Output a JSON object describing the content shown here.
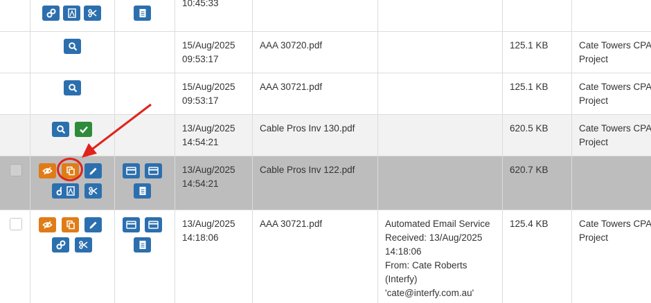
{
  "rows": [
    {
      "datetime": [
        "",
        "10:45:33"
      ],
      "filename": "",
      "source": [],
      "size": "",
      "project": []
    },
    {
      "datetime": [
        "15/Aug/2025",
        "09:53:17"
      ],
      "filename": "AAA 30720.pdf",
      "source": [],
      "size": "125.1 KB",
      "project": [
        "Cate Towers CPAP",
        "Project"
      ]
    },
    {
      "datetime": [
        "15/Aug/2025",
        "09:53:17"
      ],
      "filename": "AAA 30721.pdf",
      "source": [],
      "size": "125.1 KB",
      "project": [
        "Cate Towers CPAP",
        "Project"
      ]
    },
    {
      "datetime": [
        "13/Aug/2025",
        "14:54:21"
      ],
      "filename": "Cable Pros Inv 130.pdf",
      "source": [],
      "size": "620.5 KB",
      "project": [
        "Cate Towers CPAP",
        "Project"
      ]
    },
    {
      "datetime": [
        "13/Aug/2025",
        "14:54:21"
      ],
      "filename": "Cable Pros Inv 122.pdf",
      "source": [],
      "size": "620.7 KB",
      "project": []
    },
    {
      "datetime": [
        "13/Aug/2025",
        "14:18:06"
      ],
      "filename": "AAA 30721.pdf",
      "source": [
        "Automated Email Service",
        "Received: 13/Aug/2025",
        "14:18:06",
        "From: Cate Roberts",
        "(Interfy)",
        "'cate@interfy.com.au'"
      ],
      "size": "125.4 KB",
      "project": [
        "Cate Towers CPAP",
        "Project"
      ]
    }
  ],
  "colors": {
    "blue_button": "#2c6fae",
    "green_button": "#2e8b3a",
    "orange_button": "#e07c17",
    "selected_row": "#bdbdbd",
    "annotation_red": "#e0231a"
  },
  "icons": [
    "link-icon",
    "pdf-icon",
    "scissors-icon",
    "document-icon",
    "search-icon",
    "check-icon",
    "hide-icon",
    "copy-icon",
    "pencil-icon",
    "card-icon"
  ]
}
